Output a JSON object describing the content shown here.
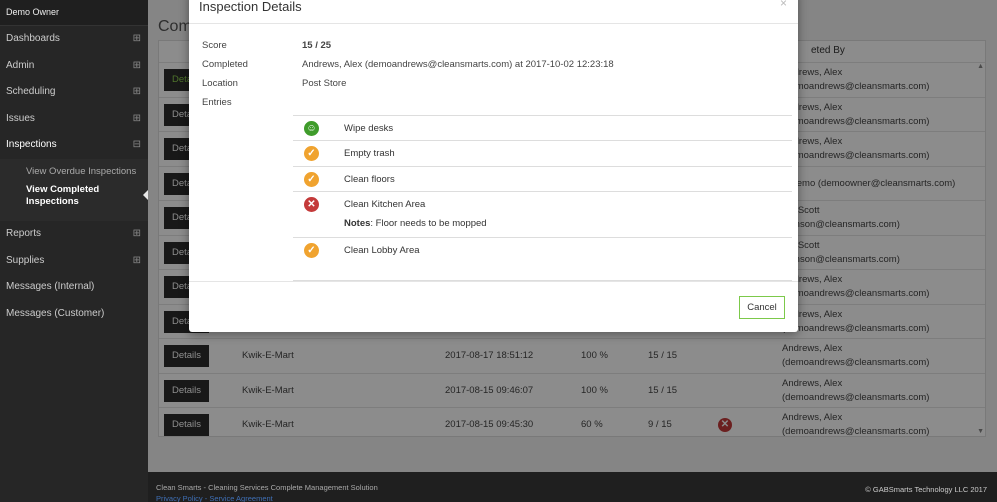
{
  "sidebar": {
    "owner": "Demo Owner",
    "items": [
      {
        "label": "Dashboards",
        "expand": "⊞"
      },
      {
        "label": "Admin",
        "expand": "⊞"
      },
      {
        "label": "Scheduling",
        "expand": "⊞"
      },
      {
        "label": "Issues",
        "expand": "⊞"
      },
      {
        "label": "Inspections",
        "expand": "⊟"
      }
    ],
    "subitems": [
      {
        "label": "View Overdue Inspections"
      },
      {
        "label": "View Completed Inspections"
      }
    ],
    "items_after": [
      {
        "label": "Reports",
        "expand": "⊞"
      },
      {
        "label": "Supplies",
        "expand": "⊞"
      },
      {
        "label": "Messages (Internal)",
        "expand": ""
      },
      {
        "label": "Messages (Customer)",
        "expand": ""
      }
    ]
  },
  "main": {
    "title_partial": "Comp",
    "completed_by_header_partial": "eted By",
    "details_label": "Details",
    "rows": [
      {
        "location": "",
        "completed": "",
        "percent": "",
        "score": "",
        "by1": "Andrews, Alex",
        "by2": "(demoandrews@cleansmarts.com)"
      },
      {
        "location": "",
        "completed": "",
        "percent": "",
        "score": "",
        "by1": "Andrews, Alex",
        "by2": "(demoandrews@cleansmarts.com)"
      },
      {
        "location": "",
        "completed": "",
        "percent": "",
        "score": "",
        "by1": "Andrews, Alex",
        "by2": "(demoandrews@cleansmarts.com)"
      },
      {
        "location": "",
        "completed": "",
        "percent": "",
        "score": "",
        "by1": "r, Demo (demoowner@cleansmarts.com)",
        "by2": ""
      },
      {
        "location": "",
        "completed": "",
        "percent": "",
        "score": "",
        "by1": "on, Scott",
        "by2": "johnson@cleansmarts.com)"
      },
      {
        "location": "",
        "completed": "",
        "percent": "",
        "score": "",
        "by1": "on, Scott",
        "by2": "johnson@cleansmarts.com)"
      },
      {
        "location": "",
        "completed": "",
        "percent": "",
        "score": "",
        "by1": "Andrews, Alex",
        "by2": "(demoandrews@cleansmarts.com)"
      },
      {
        "location": "",
        "completed": "",
        "percent": "",
        "score": "",
        "by1": "Andrews, Alex",
        "by2": "(demoandrews@cleansmarts.com)"
      },
      {
        "location": "Kwik-E-Mart",
        "completed": "2017-08-17 18:51:12",
        "percent": "100 %",
        "score": "15 / 15",
        "by1": "Andrews, Alex",
        "by2": "(demoandrews@cleansmarts.com)"
      },
      {
        "location": "Kwik-E-Mart",
        "completed": "2017-08-15 09:46:07",
        "percent": "100 %",
        "score": "15 / 15",
        "by1": "Andrews, Alex",
        "by2": "(demoandrews@cleansmarts.com)"
      },
      {
        "location": "Kwik-E-Mart",
        "completed": "2017-08-15 09:45:30",
        "percent": "60 %",
        "score": "9 / 15",
        "by1": "Andrews, Alex",
        "by2": "(demoandrews@cleansmarts.com)"
      }
    ]
  },
  "modal": {
    "title": "Inspection Details",
    "close": "×",
    "score_label": "Score",
    "score_value": "15 / 25",
    "completed_label": "Completed",
    "completed_value": "Andrews, Alex (demoandrews@cleansmarts.com) at 2017-10-02 12:23:18",
    "location_label": "Location",
    "location_value": "Post Store",
    "entries_label": "Entries",
    "entries": [
      {
        "label": "Wipe desks",
        "icon": "smile-icon",
        "glyph": "☺"
      },
      {
        "label": "Empty trash",
        "icon": "check-icon",
        "glyph": "✓"
      },
      {
        "label": "Clean floors",
        "icon": "check-icon",
        "glyph": "✓"
      },
      {
        "label": "Clean Kitchen Area",
        "icon": "fail-icon",
        "glyph": "✕",
        "notes_label": "Notes",
        "notes": ": Floor needs to be mopped"
      },
      {
        "label": "Clean Lobby Area",
        "icon": "check-icon",
        "glyph": "✓"
      }
    ],
    "cancel_label": "Cancel"
  },
  "footer": {
    "left": "Clean Smarts - Cleaning Services Complete Management Solution",
    "privacy": "Privacy Policy",
    "sep": "-",
    "service": "Service Agreement",
    "right": "© GABSmarts Technology LLC 2017"
  }
}
